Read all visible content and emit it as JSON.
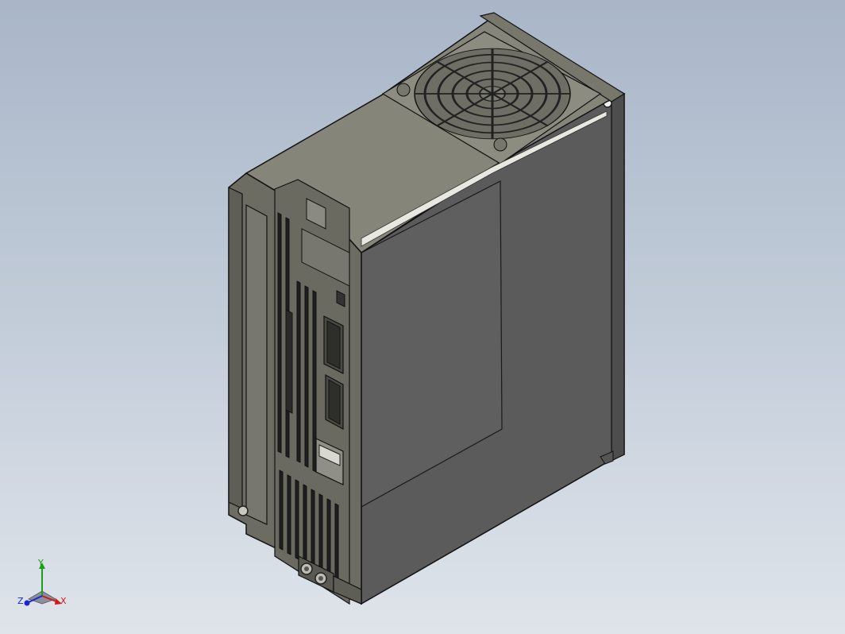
{
  "colors": {
    "background_top": "#a9b6c8",
    "background_bottom": "#dfe4ea",
    "body_side": "#5a5a5a",
    "body_front": "#6c6c63",
    "body_top": "#858579",
    "edge": "#1a1a1a",
    "axis_x": "#d01818",
    "axis_y": "#18a018",
    "axis_z": "#1828d0"
  },
  "model": {
    "name": "servo-drive-3d-model",
    "features": [
      "cooling-fan-grille",
      "front-ventilation-slots",
      "connector-ports",
      "ground-terminals",
      "mounting-holes"
    ]
  },
  "triad": {
    "x_label": "X",
    "y_label": "Y",
    "z_label": "Z"
  }
}
